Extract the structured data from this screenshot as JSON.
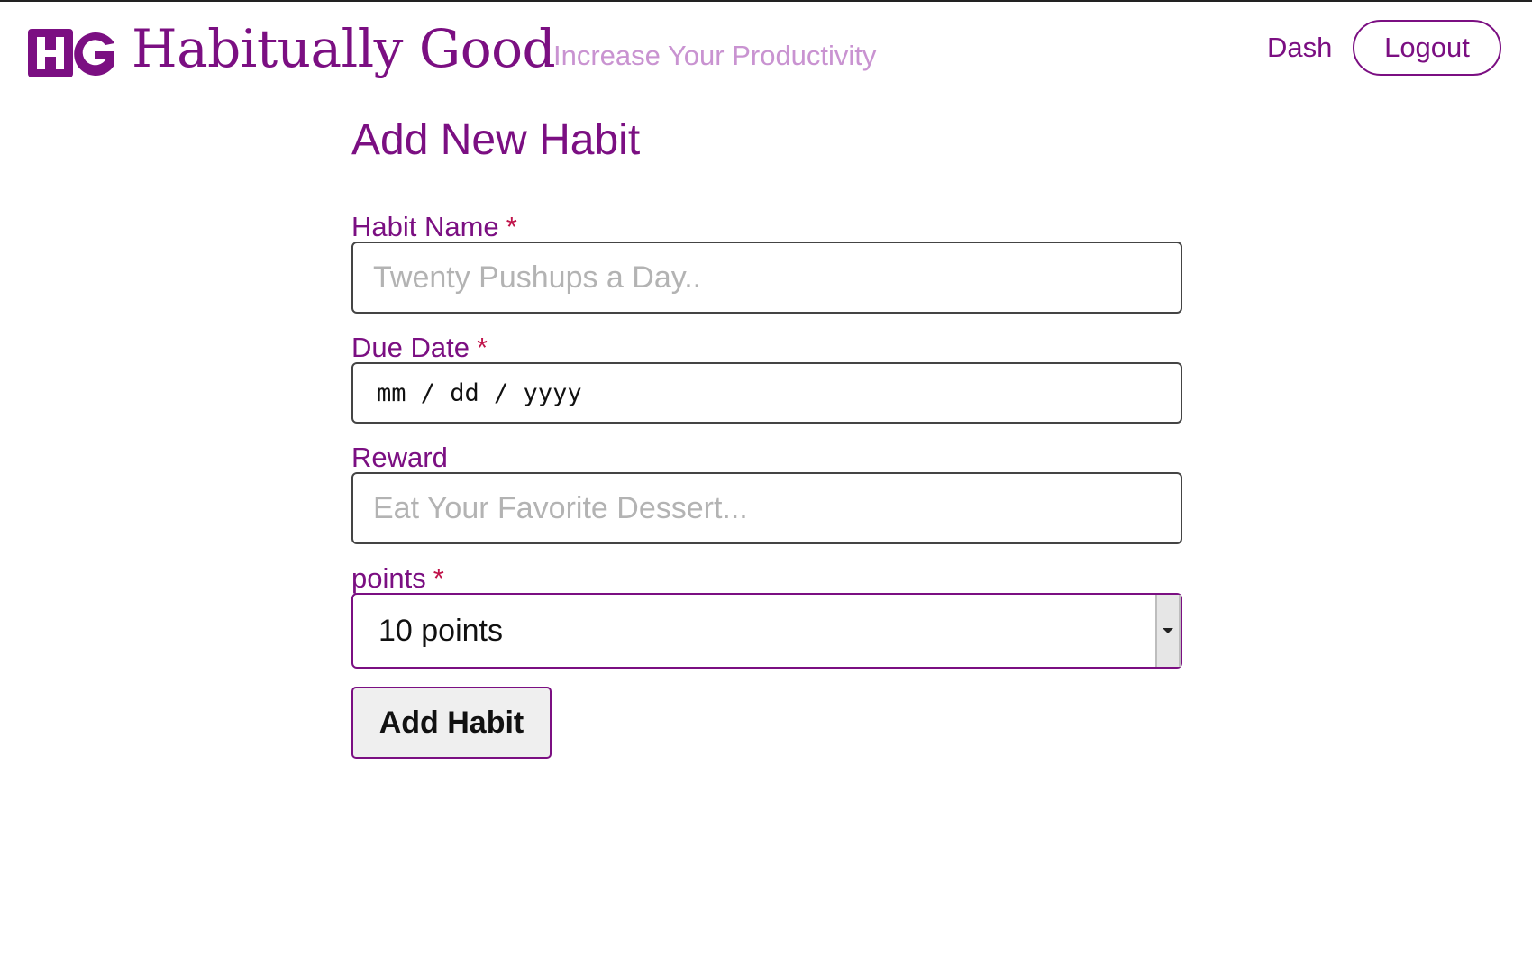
{
  "header": {
    "brand_title": "Habitually Good",
    "tagline": "Increase Your Productivity",
    "logo_icon": "hg-logo-icon",
    "nav": {
      "dash_label": "Dash",
      "logout_label": "Logout"
    }
  },
  "form": {
    "title": "Add New Habit",
    "fields": {
      "habit_name": {
        "label": "Habit Name",
        "required_mark": "*",
        "placeholder": "Twenty Pushups a Day..",
        "value": ""
      },
      "due_date": {
        "label": "Due Date",
        "required_mark": "*",
        "display": "mm / dd / yyyy"
      },
      "reward": {
        "label": "Reward",
        "placeholder": "Eat Your Favorite Dessert...",
        "value": ""
      },
      "points": {
        "label": "points",
        "required_mark": "*",
        "selected": "10 points"
      }
    },
    "submit_label": "Add Habit"
  },
  "colors": {
    "accent": "#7b0f82",
    "tagline": "#c993d1",
    "required": "#c0134a"
  }
}
